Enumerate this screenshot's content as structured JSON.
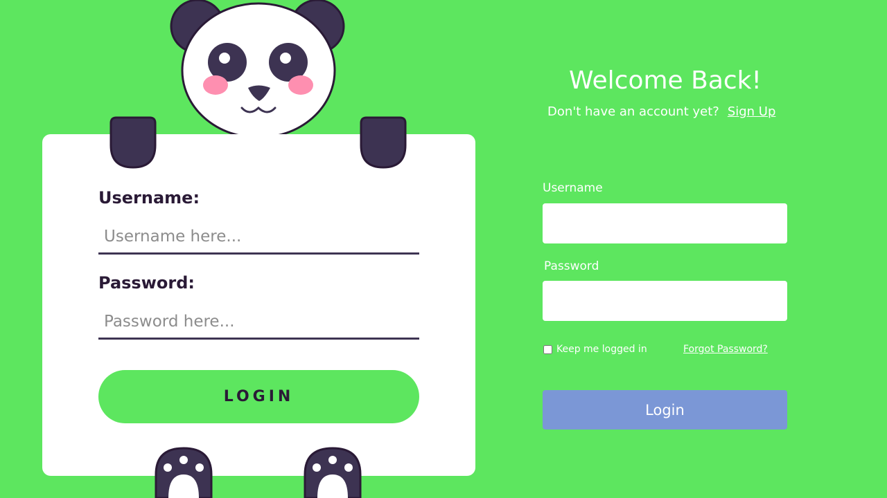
{
  "panda_form": {
    "username_label": "Username:",
    "username_placeholder": "Username here...",
    "password_label": "Password:",
    "password_placeholder": "Password here...",
    "login_label": "LOGIN"
  },
  "login_form": {
    "title": "Welcome Back!",
    "signup_prompt": "Don't have an account yet?",
    "signup_link": "Sign Up",
    "username_label": "Username",
    "username_value": "",
    "password_label": "Password",
    "password_value": "",
    "remember_label": "Keep me logged in",
    "remember_checked": false,
    "forgot_link": "Forgot Password?",
    "login_label": "Login"
  },
  "colors": {
    "background": "#5de65f",
    "panda_dark": "#3d3352",
    "panda_blush": "#fe8fb0",
    "login_button": "#7b97d6"
  }
}
